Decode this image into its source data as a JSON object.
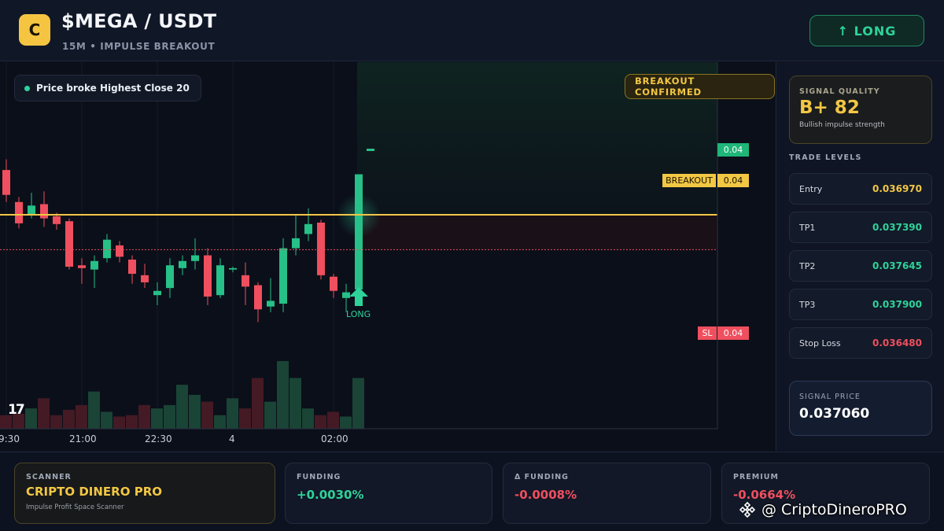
{
  "header": {
    "logo_letter": "C",
    "pair": "$MEGA / USDT",
    "subtitle": "15M • IMPULSE BREAKOUT",
    "long_button": "↑ LONG"
  },
  "chart": {
    "chip_text": "Price broke Highest Close 20",
    "confirmed_badge": "BREAKOUT CONFIRMED",
    "tv_logo": "17",
    "long_marker_label": "LONG",
    "tags": {
      "current_price": "0.04",
      "breakout_label": "BREAKOUT",
      "breakout_price": "0.04",
      "sl_label": "SL",
      "sl_price": "0.04"
    },
    "xticks": [
      "9:30",
      "21:00",
      "22:30",
      "4",
      "02:00"
    ]
  },
  "chart_data": {
    "type": "candlestick",
    "candles": [
      {
        "o": 0.0376,
        "h": 0.03775,
        "l": 0.03715,
        "c": 0.03725
      },
      {
        "o": 0.03715,
        "h": 0.03722,
        "l": 0.03678,
        "c": 0.03685
      },
      {
        "o": 0.03698,
        "h": 0.03728,
        "l": 0.03692,
        "c": 0.0371
      },
      {
        "o": 0.03712,
        "h": 0.0373,
        "l": 0.0368,
        "c": 0.03692
      },
      {
        "o": 0.03695,
        "h": 0.037,
        "l": 0.03676,
        "c": 0.03684
      },
      {
        "o": 0.03688,
        "h": 0.03692,
        "l": 0.0362,
        "c": 0.03624
      },
      {
        "o": 0.03626,
        "h": 0.03636,
        "l": 0.036,
        "c": 0.03622
      },
      {
        "o": 0.0362,
        "h": 0.0364,
        "l": 0.03594,
        "c": 0.03632
      },
      {
        "o": 0.03636,
        "h": 0.0367,
        "l": 0.0363,
        "c": 0.03662
      },
      {
        "o": 0.03654,
        "h": 0.0366,
        "l": 0.0363,
        "c": 0.03638
      },
      {
        "o": 0.03634,
        "h": 0.0364,
        "l": 0.036,
        "c": 0.03614
      },
      {
        "o": 0.03612,
        "h": 0.03628,
        "l": 0.03594,
        "c": 0.03602
      },
      {
        "o": 0.03584,
        "h": 0.03602,
        "l": 0.0357,
        "c": 0.0359
      },
      {
        "o": 0.03594,
        "h": 0.03636,
        "l": 0.0358,
        "c": 0.03626
      },
      {
        "o": 0.03622,
        "h": 0.0364,
        "l": 0.03612,
        "c": 0.03632
      },
      {
        "o": 0.03632,
        "h": 0.03664,
        "l": 0.0362,
        "c": 0.0364
      },
      {
        "o": 0.0364,
        "h": 0.0365,
        "l": 0.0357,
        "c": 0.03582
      },
      {
        "o": 0.03584,
        "h": 0.03636,
        "l": 0.0358,
        "c": 0.03626
      },
      {
        "o": 0.0362,
        "h": 0.03624,
        "l": 0.03616,
        "c": 0.03622
      },
      {
        "o": 0.03612,
        "h": 0.0363,
        "l": 0.0357,
        "c": 0.03596
      },
      {
        "o": 0.03598,
        "h": 0.03602,
        "l": 0.03546,
        "c": 0.03564
      },
      {
        "o": 0.03568,
        "h": 0.03608,
        "l": 0.0356,
        "c": 0.03576
      },
      {
        "o": 0.03572,
        "h": 0.03664,
        "l": 0.0356,
        "c": 0.0365
      },
      {
        "o": 0.0365,
        "h": 0.03696,
        "l": 0.0364,
        "c": 0.03664
      },
      {
        "o": 0.0367,
        "h": 0.03706,
        "l": 0.0366,
        "c": 0.03684
      },
      {
        "o": 0.03686,
        "h": 0.0369,
        "l": 0.03606,
        "c": 0.03612
      },
      {
        "o": 0.0361,
        "h": 0.03614,
        "l": 0.0358,
        "c": 0.0359
      },
      {
        "o": 0.0358,
        "h": 0.036,
        "l": 0.0356,
        "c": 0.03588
      },
      {
        "o": 0.03592,
        "h": 0.03718,
        "l": 0.0358,
        "c": 0.03754
      }
    ],
    "volumes": [
      0.2,
      0.22,
      0.3,
      0.45,
      0.2,
      0.28,
      0.35,
      0.55,
      0.25,
      0.18,
      0.2,
      0.35,
      0.3,
      0.35,
      0.65,
      0.5,
      0.4,
      0.2,
      0.45,
      0.3,
      0.75,
      0.4,
      1.0,
      0.75,
      0.3,
      0.2,
      0.25,
      0.18,
      0.75
    ],
    "breakout_level": 0.03697,
    "stop_loss_level": 0.03648,
    "current_price_level": 0.0379,
    "ylim": [
      0.0353,
      0.0379
    ]
  },
  "panel": {
    "quality_label": "SIGNAL QUALITY",
    "quality_value": "B+ 82",
    "quality_desc": "Bullish impulse strength",
    "levels_title": "TRADE LEVELS",
    "levels": [
      {
        "name": "Entry",
        "value": "0.036970",
        "color": "#f2c744"
      },
      {
        "name": "TP1",
        "value": "0.037390",
        "color": "#2ed39a"
      },
      {
        "name": "TP2",
        "value": "0.037645",
        "color": "#2ed39a"
      },
      {
        "name": "TP3",
        "value": "0.037900",
        "color": "#2ed39a"
      },
      {
        "name": "Stop Loss",
        "value": "0.036480",
        "color": "#ef4f5e"
      }
    ],
    "signal_price_label": "SIGNAL PRICE",
    "signal_price_value": "0.037060"
  },
  "bottom": {
    "scanner_label": "SCANNER",
    "scanner_value": "CRIPTO DINERO PRO",
    "scanner_desc": "Impulse Profit Space Scanner",
    "funding_label": "FUNDING",
    "funding_value": "+0.0030%",
    "dfunding_label": "Δ FUNDING",
    "dfunding_value": "-0.0008%",
    "premium_label": "PREMIUM",
    "premium_value": "-0.0664%"
  },
  "watermark": {
    "text": "@ CriptoDineroPRO"
  },
  "colors": {
    "green": "#26c088",
    "red": "#ef4f5e",
    "yellow": "#f2c744"
  }
}
